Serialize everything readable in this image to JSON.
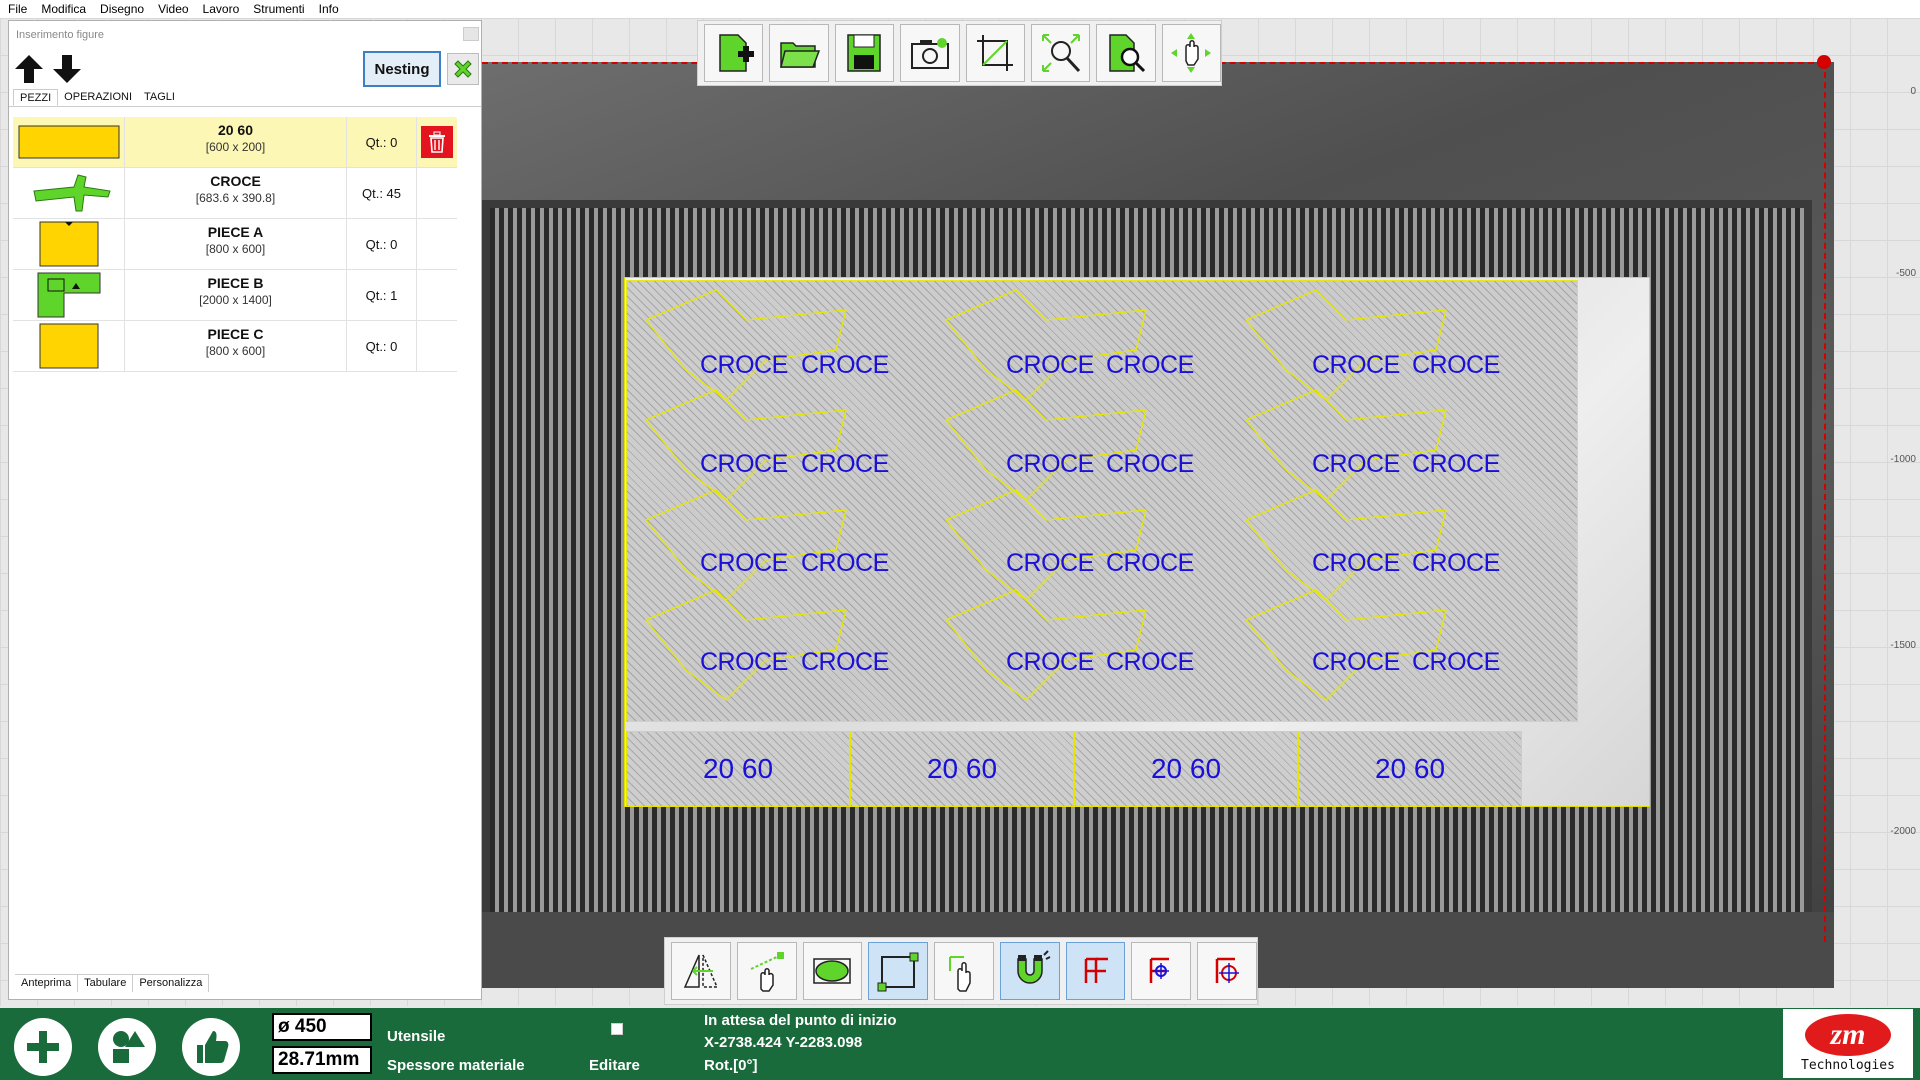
{
  "menu": [
    "File",
    "Modifica",
    "Disegno",
    "Video",
    "Lavoro",
    "Strumenti",
    "Info"
  ],
  "panel": {
    "title": "Inserimento figure",
    "nesting_label": "Nesting",
    "tabs": [
      "PEZZI",
      "OPERAZIONI",
      "TAGLI"
    ],
    "bottom_tabs": [
      "Anteprima",
      "Tabulare",
      "Personalizza"
    ],
    "pieces": [
      {
        "name": "20 60",
        "dims": "[600 x 200]",
        "qty": "Qt.: 0",
        "selected": true,
        "shape": "rect-wide"
      },
      {
        "name": "CROCE",
        "dims": "[683.6 x 390.8]",
        "qty": "Qt.: 45",
        "selected": false,
        "shape": "cross"
      },
      {
        "name": "PIECE A",
        "dims": "[800 x 600]",
        "qty": "Qt.: 0",
        "selected": false,
        "shape": "rect"
      },
      {
        "name": "PIECE B",
        "dims": "[2000 x 1400]",
        "qty": "Qt.: 1",
        "selected": false,
        "shape": "l-shape"
      },
      {
        "name": "PIECE C",
        "dims": "[800 x 600]",
        "qty": "Qt.: 0",
        "selected": false,
        "shape": "rect"
      }
    ]
  },
  "canvas": {
    "ruler": [
      "0",
      "-500",
      "-1000",
      "-1500",
      "-2000"
    ],
    "croce_label": "CROCE",
    "rect_label": "20 60",
    "rect_count": 4
  },
  "top_toolbar": [
    "new-piece-icon",
    "open-folder-icon",
    "save-icon",
    "camera-icon",
    "crop-icon",
    "zoom-fit-icon",
    "zoom-search-icon",
    "pan-hand-icon"
  ],
  "bottom_toolbar": [
    "mirror-icon",
    "move-hand-icon",
    "ellipse-icon",
    "rectangle-select-icon",
    "touch-select-icon",
    "magnet-icon",
    "origin-f-icon",
    "origin-center-icon",
    "origin-target-icon"
  ],
  "status": {
    "diameter": "ø 450",
    "thickness": "28.71mm",
    "tool_label": "Utensile",
    "thickness_label": "Spessore materiale",
    "edit_label": "Editare",
    "message": "In attesa del punto di inizio",
    "coords": "X-2738.424 Y-2283.098",
    "rotation": "Rot.[0°]",
    "logo_text": "Technologies",
    "logo_mark": "zm"
  },
  "colors": {
    "status_bg": "#1a6b3c",
    "croce_text": "#1a10d8",
    "piece_fill": "#ffd400",
    "cross_fill": "#5fd42a",
    "delete": "#e3131f"
  }
}
